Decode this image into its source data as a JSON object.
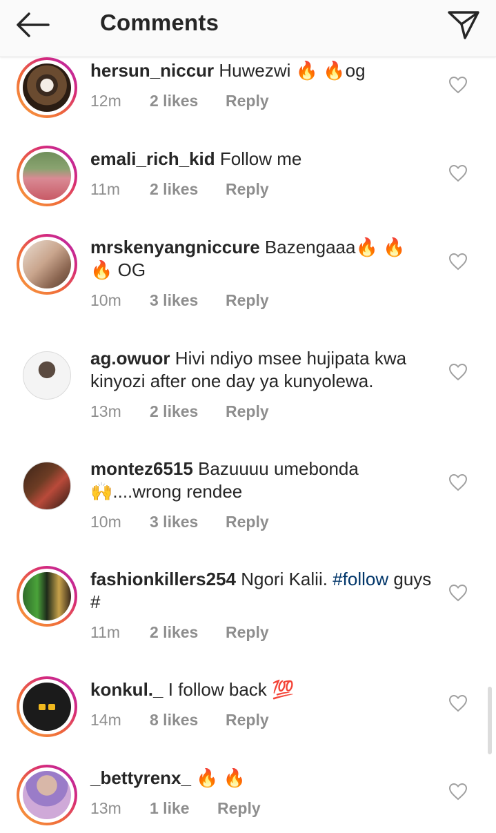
{
  "header": {
    "title": "Comments",
    "back_icon": "arrow-left-icon",
    "send_icon": "paper-plane-icon"
  },
  "colors": {
    "accent_hashtag": "#003569",
    "meta_gray": "#8e8e8e",
    "story_ring_start": "#f9a03f",
    "story_ring_end": "#b12ab5"
  },
  "comments": [
    {
      "username": "hersun_niccur",
      "text": "Huwezwi 🔥 🔥og",
      "time": "12m",
      "likes": "2 likes",
      "reply": "Reply",
      "story_ring": true
    },
    {
      "username": "emali_rich_kid",
      "text": "Follow me",
      "time": "11m",
      "likes": "2 likes",
      "reply": "Reply",
      "story_ring": true
    },
    {
      "username": "mrskenyangniccure",
      "text": "Bazengaaa🔥 🔥 🔥 OG",
      "time": "10m",
      "likes": "3 likes",
      "reply": "Reply",
      "story_ring": true
    },
    {
      "username": "ag.owuor",
      "text": "Hivi ndiyo msee hujipata kwa kinyozi after one day ya kunyolewa.",
      "time": "13m",
      "likes": "2 likes",
      "reply": "Reply",
      "story_ring": false
    },
    {
      "username": "montez6515",
      "text": "Bazuuuu umebonda 🙌....wrong rendee",
      "time": "10m",
      "likes": "3 likes",
      "reply": "Reply",
      "story_ring": false
    },
    {
      "username": "fashionkillers254",
      "text_before": "Ngori Kalii.",
      "hashtag": "#follow",
      "text_after": "guys #",
      "time": "11m",
      "likes": "2 likes",
      "reply": "Reply",
      "story_ring": true
    },
    {
      "username": "konkul._",
      "text": "I follow back 💯",
      "time": "14m",
      "likes": "8 likes",
      "reply": "Reply",
      "story_ring": true
    },
    {
      "username": "_bettyrenx_",
      "text": "🔥 🔥",
      "time": "13m",
      "likes": "1 like",
      "reply": "Reply",
      "story_ring": true
    }
  ]
}
